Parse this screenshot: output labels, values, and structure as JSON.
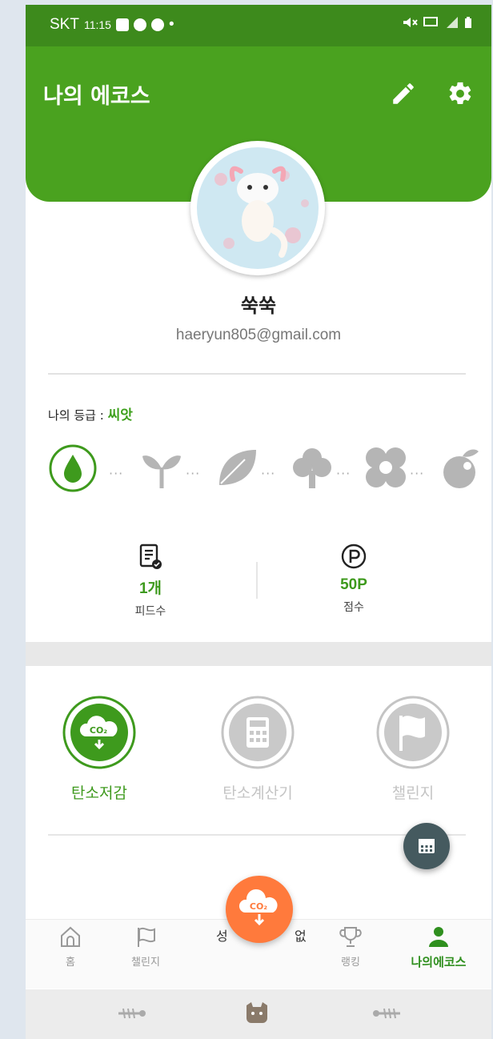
{
  "status_bar": {
    "carrier": "SKT",
    "time": "11:15",
    "dot": "•"
  },
  "header": {
    "title": "나의 에코스",
    "edit_icon": "pencil-icon",
    "settings_icon": "gear-icon"
  },
  "profile": {
    "nickname": "쑥쑥",
    "email": "haeryun805@gmail.com",
    "avatar_icon": "axolotl-avatar"
  },
  "grade": {
    "label": "나의 등급 : ",
    "value": "씨앗",
    "steps": [
      "seed-drop-icon",
      "sprout-icon",
      "leaf-icon",
      "tree-icon",
      "flower-icon",
      "apple-icon"
    ],
    "dots": "···"
  },
  "stats": [
    {
      "icon": "feed-document-icon",
      "value": "1개",
      "label": "피드수"
    },
    {
      "icon": "point-p-icon",
      "value": "50P",
      "label": "점수"
    }
  ],
  "menus": [
    {
      "label": "탄소저감",
      "icon": "co2-cloud-icon",
      "active": true
    },
    {
      "label": "탄소계산기",
      "icon": "calculator-icon",
      "active": false
    },
    {
      "label": "챌린지",
      "icon": "flag-icon",
      "active": false
    }
  ],
  "bottom_nav": {
    "items": [
      {
        "label": "홈",
        "icon": "home-icon"
      },
      {
        "label": "챌린지",
        "icon": "flag-icon"
      },
      {
        "label": "랭킹",
        "icon": "trophy-icon"
      },
      {
        "label": "나의에코스",
        "icon": "person-icon"
      }
    ],
    "partial_left": "성",
    "partial_right": "없"
  },
  "colors": {
    "primary_green": "#4aa21f",
    "accent_orange": "#ff7a3c",
    "fab_dark": "#455a5f"
  }
}
